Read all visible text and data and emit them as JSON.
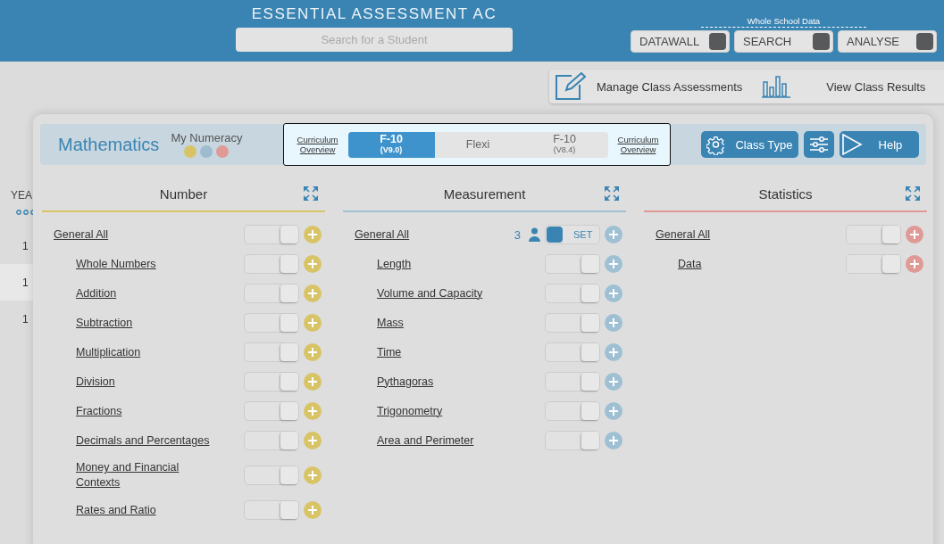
{
  "header": {
    "title": "ESSENTIAL ASSESSMENT AC",
    "search": {
      "placeholder": "Search for a Student"
    },
    "whole_school": {
      "label": "Whole School Data",
      "buttons": [
        {
          "label": "DATAWALL"
        },
        {
          "label": "SEARCH"
        },
        {
          "label": "ANALYSE"
        }
      ]
    }
  },
  "toolbar": {
    "buttons": [
      {
        "label": "Manage Class Assessments",
        "kind": "edit"
      },
      {
        "label": "View Class Results",
        "kind": "chart"
      }
    ]
  },
  "background_table": {
    "column_1": "YEA",
    "rows": [
      "1",
      "1",
      "1"
    ]
  },
  "panel": {
    "subject": "Mathematics",
    "program": {
      "label": "My Numeracy",
      "dots": [
        {
          "color": "#d8c466"
        },
        {
          "color": "#9fbbd0"
        },
        {
          "color": "#e09a96"
        }
      ]
    },
    "curriculum": {
      "left_link": "Curriculum Overview",
      "right_link": "Curriculum Overview",
      "options": [
        {
          "label": "F-10",
          "version": "(V9.0)",
          "selected": true
        },
        {
          "label": "Flexi",
          "selected": false
        },
        {
          "label": "F-10",
          "version": "(V8.4)",
          "selected": false
        }
      ]
    },
    "buttons": [
      {
        "kind": "gear",
        "label": "Class Type"
      },
      {
        "kind": "sliders"
      },
      {
        "kind": "play",
        "label": "Help"
      }
    ],
    "strands": [
      {
        "title": "Number",
        "color": "#d8c466",
        "items": [
          {
            "label": "General All",
            "on": false,
            "children": [
              {
                "label": "Whole Numbers",
                "on": false
              },
              {
                "label": "Addition",
                "on": false
              },
              {
                "label": "Subtraction",
                "on": false
              },
              {
                "label": "Multiplication",
                "on": false
              },
              {
                "label": "Division",
                "on": false
              },
              {
                "label": "Fractions",
                "on": false
              },
              {
                "label": "Decimals and Percentages",
                "on": false
              },
              {
                "label": "Money and Financial Contexts",
                "on": false
              },
              {
                "label": "Rates and Ratio",
                "on": false
              }
            ]
          }
        ]
      },
      {
        "title": "Measurement",
        "color": "#9fbfd3",
        "items": [
          {
            "label": "General All",
            "on": true,
            "on_label": "SET",
            "count": "3",
            "children": [
              {
                "label": "Length",
                "on": false
              },
              {
                "label": "Volume and Capacity",
                "on": false
              },
              {
                "label": "Mass",
                "on": false
              },
              {
                "label": "Time",
                "on": false
              },
              {
                "label": "Pythagoras",
                "on": false
              },
              {
                "label": "Trigonometry",
                "on": false
              },
              {
                "label": "Area and Perimeter",
                "on": false
              }
            ]
          }
        ]
      },
      {
        "title": "Statistics",
        "color": "#e09a96",
        "items": [
          {
            "label": "General All",
            "on": false,
            "children": [
              {
                "label": "Data",
                "on": false
              }
            ]
          }
        ]
      }
    ]
  }
}
